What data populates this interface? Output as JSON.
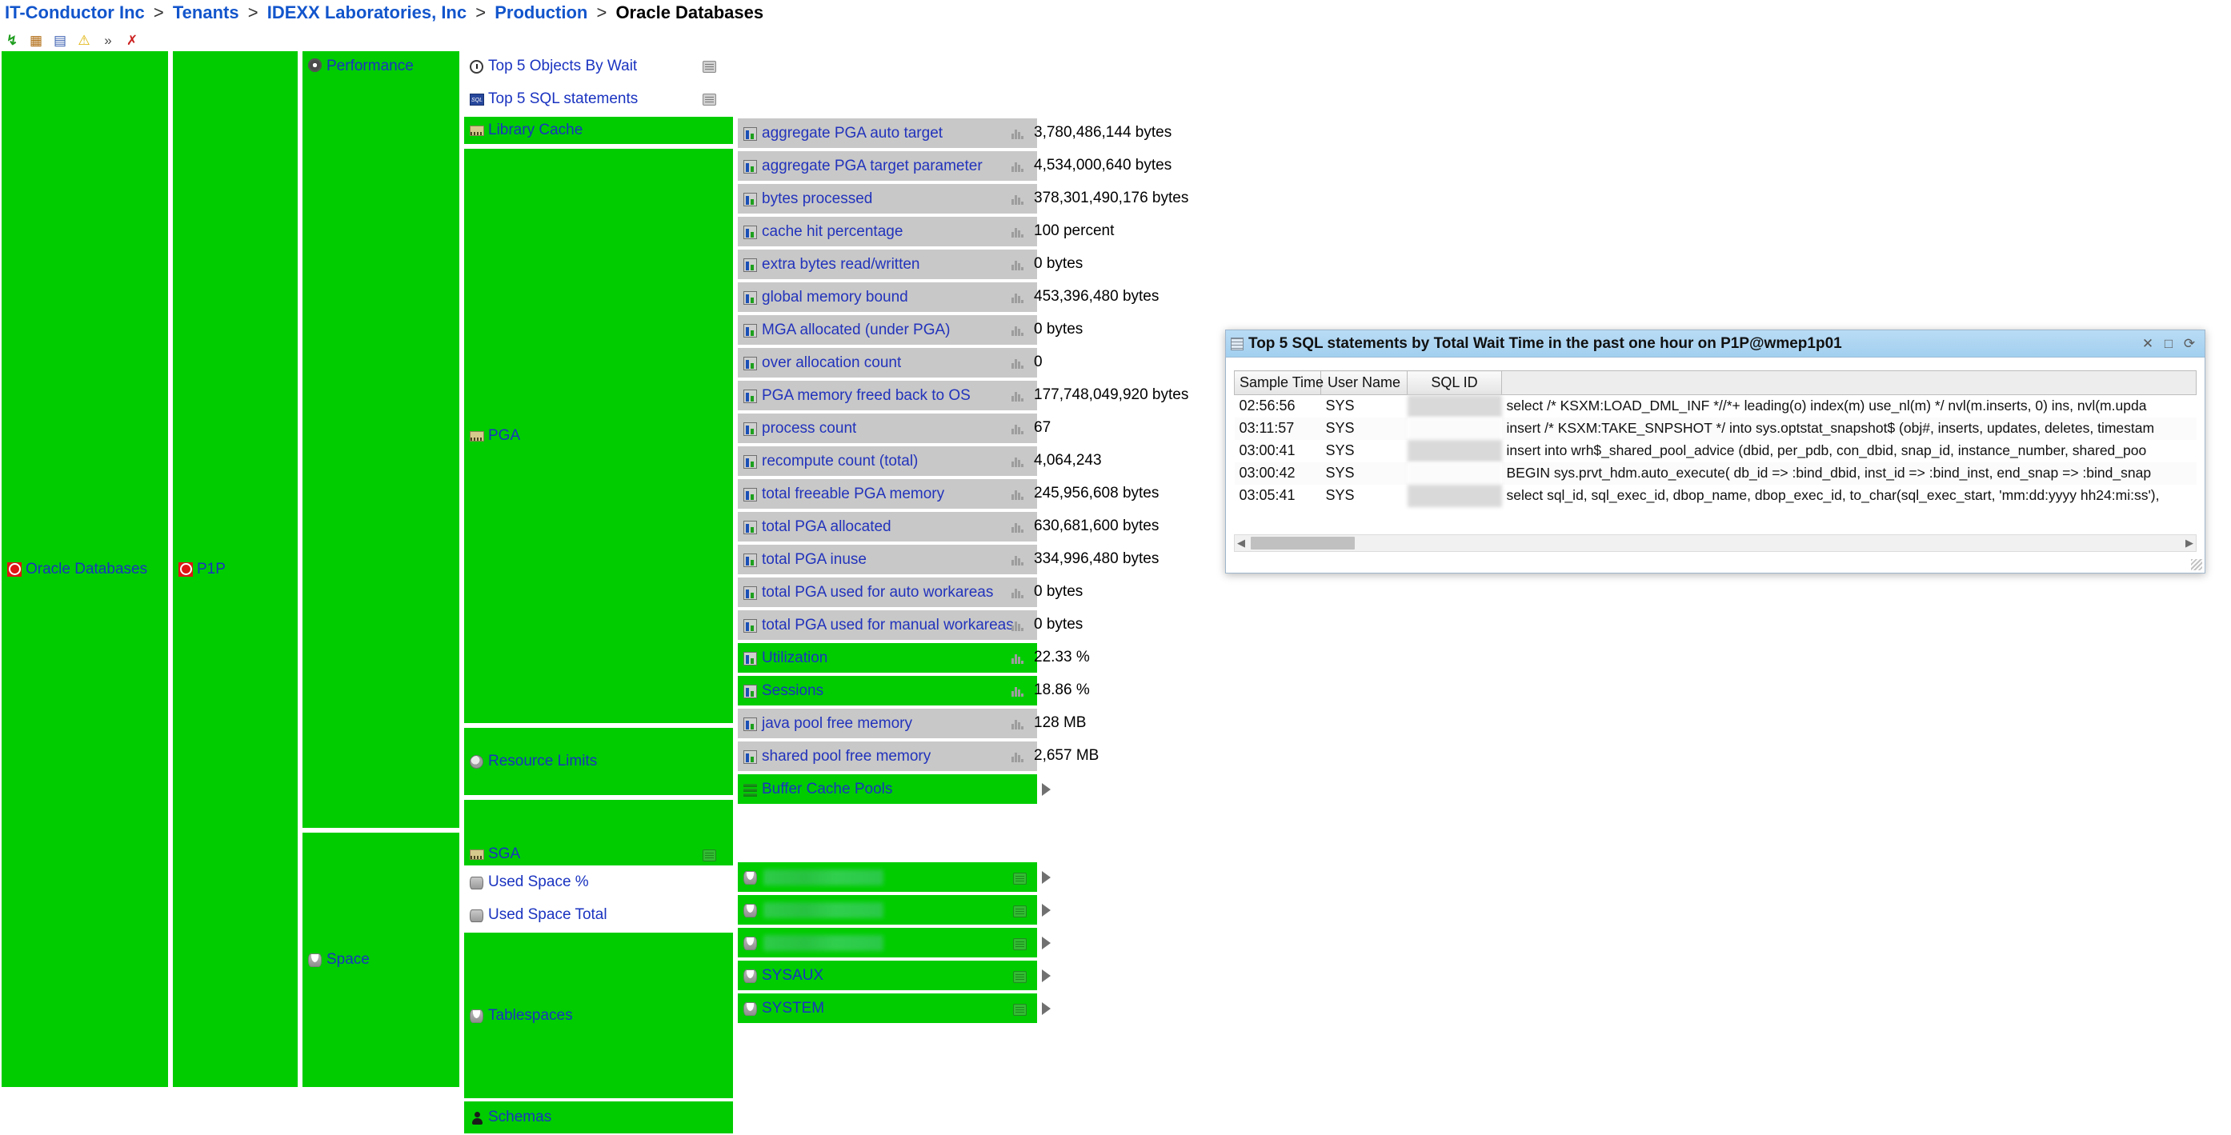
{
  "breadcrumb": {
    "items": [
      {
        "label": "IT-Conductor Inc",
        "current": false
      },
      {
        "label": "Tenants",
        "current": false
      },
      {
        "label": "IDEXX Laboratories, Inc",
        "current": false
      },
      {
        "label": "Production",
        "current": false
      },
      {
        "label": "Oracle Databases",
        "current": true
      }
    ],
    "separator": ">"
  },
  "toolbar": {
    "icons": [
      {
        "name": "refresh-icon",
        "glyph": "↯"
      },
      {
        "name": "grid-view-icon",
        "glyph": "▦"
      },
      {
        "name": "report-icon",
        "glyph": "▤"
      },
      {
        "name": "alert-warning-icon",
        "glyph": "⚠"
      },
      {
        "name": "more-chevrons-icon",
        "glyph": "»"
      },
      {
        "name": "pin-icon",
        "glyph": "✗"
      }
    ]
  },
  "tree": {
    "root": {
      "label": "Oracle Databases",
      "icon": "red-stop-icon"
    },
    "system": {
      "label": "P1P",
      "icon": "red-stop-icon"
    },
    "groups": {
      "performance": {
        "label": "Performance",
        "icon": "gear-icon"
      },
      "space": {
        "label": "Space",
        "icon": "database-icon"
      }
    },
    "perf_children": [
      {
        "label": "Top 5 Objects By Wait",
        "icon": "clock-icon",
        "state": "white",
        "button": true
      },
      {
        "label": "Top 5 SQL statements",
        "icon": "sql-icon",
        "state": "white",
        "button": true
      },
      {
        "label": "Library Cache",
        "icon": "memory-icon",
        "state": "green",
        "expander": true
      },
      {
        "label": "PGA",
        "icon": "memory-icon",
        "state": "green"
      },
      {
        "label": "Resource Limits",
        "icon": "magnify-icon",
        "state": "green"
      },
      {
        "label": "SGA",
        "icon": "memory-icon",
        "state": "green",
        "button": true
      }
    ],
    "space_children": [
      {
        "label": "Used Space %",
        "icon": "database-icon",
        "state": "white"
      },
      {
        "label": "Used Space Total",
        "icon": "database-icon",
        "state": "white"
      },
      {
        "label": "Tablespaces",
        "icon": "database-icon",
        "state": "green"
      },
      {
        "label": "Schemas",
        "icon": "person-icon",
        "state": "green"
      }
    ],
    "pga_metrics": [
      {
        "label": "aggregate PGA auto target",
        "value": "3,780,486,144 bytes"
      },
      {
        "label": "aggregate PGA target parameter",
        "value": "4,534,000,640 bytes"
      },
      {
        "label": "bytes processed",
        "value": "378,301,490,176 bytes"
      },
      {
        "label": "cache hit percentage",
        "value": "100 percent"
      },
      {
        "label": "extra bytes read/written",
        "value": "0 bytes"
      },
      {
        "label": "global memory bound",
        "value": "453,396,480 bytes"
      },
      {
        "label": "MGA allocated (under PGA)",
        "value": "0 bytes"
      },
      {
        "label": "over allocation count",
        "value": "0"
      },
      {
        "label": "PGA memory freed back to OS",
        "value": "177,748,049,920 bytes"
      },
      {
        "label": "process count",
        "value": "67"
      },
      {
        "label": "recompute count (total)",
        "value": "4,064,243"
      },
      {
        "label": "total freeable PGA memory",
        "value": "245,956,608 bytes"
      },
      {
        "label": "total PGA allocated",
        "value": "630,681,600 bytes"
      },
      {
        "label": "total PGA inuse",
        "value": "334,996,480 bytes"
      },
      {
        "label": "total PGA used for auto workareas",
        "value": "0 bytes"
      },
      {
        "label": "total PGA used for manual workareas",
        "value": "0 bytes"
      }
    ],
    "resource_limit_metrics": [
      {
        "label": "Utilization",
        "value": "22.33 %"
      },
      {
        "label": "Sessions",
        "value": "18.86 %"
      }
    ],
    "sga_metrics": [
      {
        "label": "java pool free memory",
        "value": "128 MB"
      },
      {
        "label": "shared pool free memory",
        "value": "2,657 MB"
      },
      {
        "label": "Buffer Cache Pools",
        "value": "",
        "expander": true
      }
    ],
    "tablespaces": [
      {
        "label": "",
        "redacted": true
      },
      {
        "label": "",
        "redacted": true
      },
      {
        "label": "",
        "redacted": true
      },
      {
        "label": "SYSAUX",
        "redacted": false
      },
      {
        "label": "SYSTEM",
        "redacted": false
      }
    ]
  },
  "dialog": {
    "title": "Top 5 SQL statements by Total Wait Time in the past one hour on P1P@wmep1p01",
    "controls": {
      "close": "✕",
      "maximize": "□",
      "refresh": "⟳"
    },
    "columns": [
      "Sample Time",
      "User Name",
      "SQL ID",
      ""
    ],
    "rows": [
      {
        "sample_time": "02:56:56",
        "user_name": "SYS",
        "sql_id": "",
        "sql_text": "select /* KSXM:LOAD_DML_INF *//*+ leading(o) index(m) use_nl(m) */ nvl(m.inserts, 0) ins, nvl(m.upda"
      },
      {
        "sample_time": "03:11:57",
        "user_name": "SYS",
        "sql_id": "",
        "sql_text": "insert /* KSXM:TAKE_SNPSHOT */ into sys.optstat_snapshot$ (obj#, inserts, updates, deletes, timestam"
      },
      {
        "sample_time": "03:00:41",
        "user_name": "SYS",
        "sql_id": "",
        "sql_text": "insert into wrh$_shared_pool_advice (dbid, per_pdb, con_dbid, snap_id, instance_number, shared_poo"
      },
      {
        "sample_time": "03:00:42",
        "user_name": "SYS",
        "sql_id": "",
        "sql_text": "BEGIN sys.prvt_hdm.auto_execute( db_id => :bind_dbid, inst_id => :bind_inst, end_snap => :bind_snap"
      },
      {
        "sample_time": "03:05:41",
        "user_name": "SYS",
        "sql_id": "",
        "sql_text": "select sql_id, sql_exec_id, dbop_name, dbop_exec_id, to_char(sql_exec_start, 'mm:dd:yyyy hh24:mi:ss'),"
      }
    ],
    "scroll": {
      "left_arrow": "◀",
      "right_arrow": "▶"
    }
  },
  "colors": {
    "node_green": "#00cc00",
    "node_grey": "#c8c8c8",
    "label_blue": "#1a33c0",
    "link_blue": "#1255cc",
    "dialog_title": "#a2cfef"
  }
}
